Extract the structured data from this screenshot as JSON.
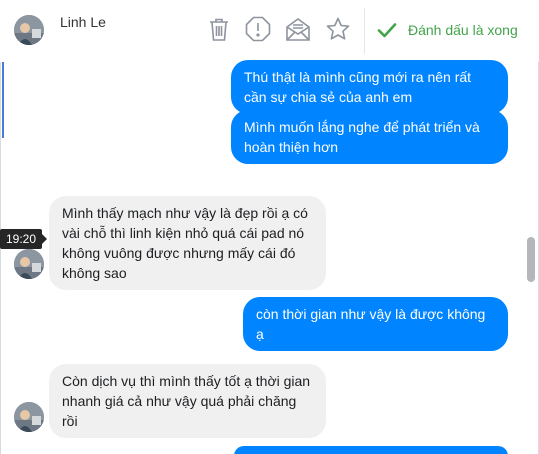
{
  "header": {
    "contact_name": "Linh Le",
    "icons": [
      "trash-icon",
      "report-icon",
      "mail-icon",
      "star-icon",
      "check-icon"
    ],
    "done_label": "Đánh dấu là xong",
    "colors": {
      "done": "#42a44a",
      "icon": "#8d949e"
    }
  },
  "conversation": {
    "messages": [
      {
        "direction": "out",
        "text": "Thú thật là mình cũng mới ra nên rất cần sự chia sẻ của anh em"
      },
      {
        "direction": "out",
        "text": "Mình muốn lắng nghe để phát triển và hoàn thiện hơn"
      },
      {
        "direction": "in",
        "text": "Mình thấy mạch như vậy là đẹp rồi ạ có vài chỗ thì linh kiện nhỏ quá cái pad nó không vuông được nhưng mấy cái đó không sao"
      },
      {
        "direction": "out",
        "text": "còn thời gian như vậy là được không ạ"
      },
      {
        "direction": "in",
        "text": "Còn dịch vụ thì mình thấy tốt ạ thời gian nhanh giá cả như vậy quá phải chăng rồi"
      },
      {
        "direction": "out",
        "text": ""
      }
    ],
    "timestamp": "19:20",
    "colors": {
      "outgoing": "#0084ff",
      "incoming": "#f0f0f0"
    }
  }
}
